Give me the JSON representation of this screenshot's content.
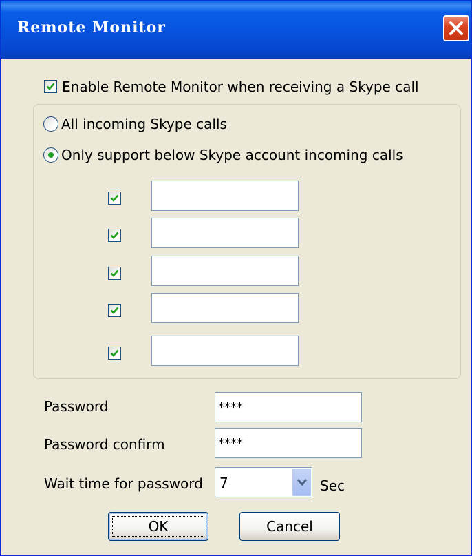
{
  "window": {
    "title": "Remote Monitor"
  },
  "enable": {
    "label": "Enable Remote Monitor when receiving a Skype call",
    "checked": true
  },
  "options": {
    "all_calls": {
      "label": "All incoming Skype calls",
      "selected": false
    },
    "only_accounts": {
      "label": "Only support below Skype account incoming calls",
      "selected": true
    }
  },
  "accounts": [
    {
      "checked": true,
      "value": ""
    },
    {
      "checked": true,
      "value": ""
    },
    {
      "checked": true,
      "value": ""
    },
    {
      "checked": true,
      "value": ""
    },
    {
      "checked": true,
      "value": ""
    }
  ],
  "password": {
    "label": "Password",
    "value": "****"
  },
  "password_confirm": {
    "label": "Password confirm",
    "value": "****"
  },
  "wait_time": {
    "label": "Wait time for password",
    "value": "7",
    "unit": "Sec"
  },
  "buttons": {
    "ok": "OK",
    "cancel": "Cancel"
  }
}
